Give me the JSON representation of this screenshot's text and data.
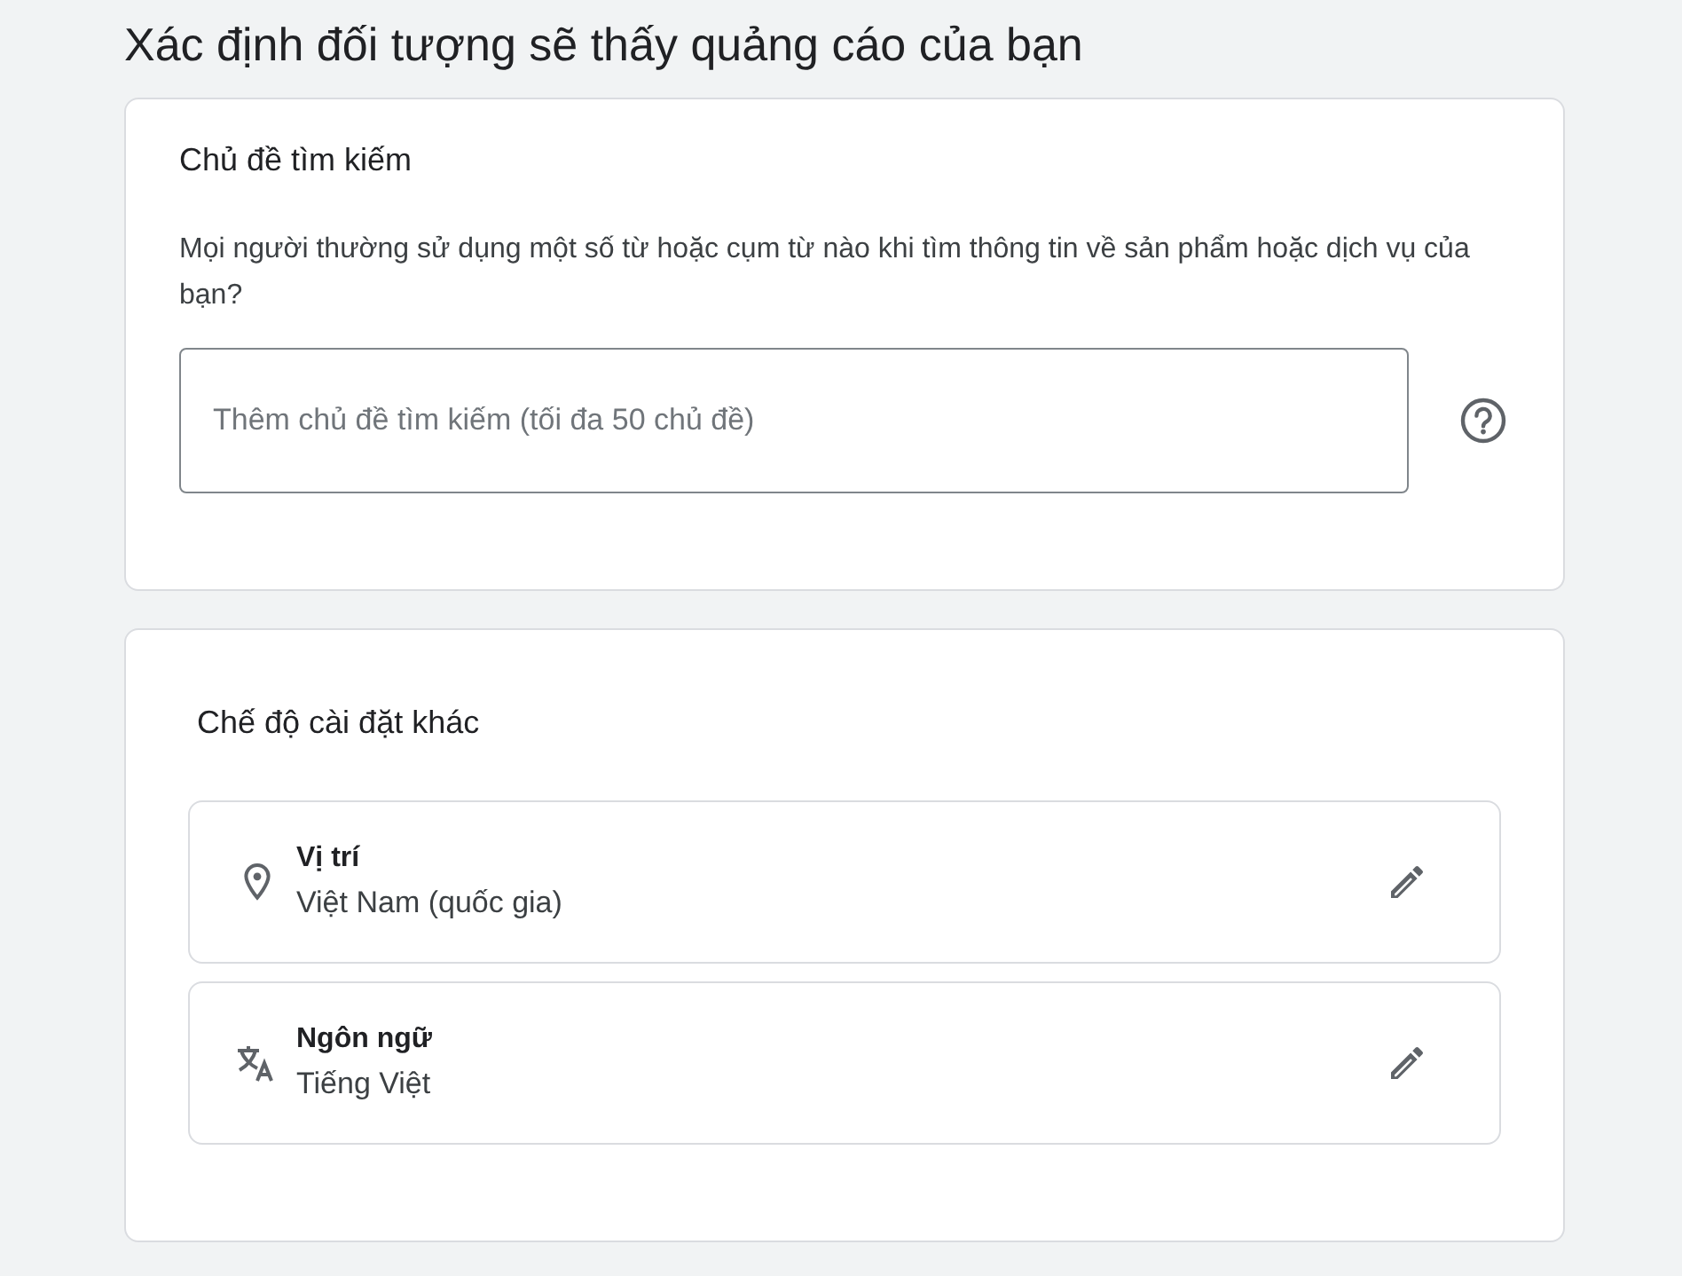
{
  "heading": "Xác định đối tượng sẽ thấy quảng cáo của bạn",
  "search_topics": {
    "title": "Chủ đề tìm kiếm",
    "description": "Mọi người thường sử dụng một số từ hoặc cụm từ nào khi tìm thông tin về sản phẩm hoặc dịch vụ của bạn?",
    "placeholder": "Thêm chủ đề tìm kiếm (tối đa 50 chủ đề)"
  },
  "other_settings": {
    "title": "Chế độ cài đặt khác",
    "items": [
      {
        "kind": "location",
        "label": "Vị trí",
        "value": "Việt Nam (quốc gia)"
      },
      {
        "kind": "language",
        "label": "Ngôn ngữ",
        "value": "Tiếng Việt"
      }
    ]
  }
}
